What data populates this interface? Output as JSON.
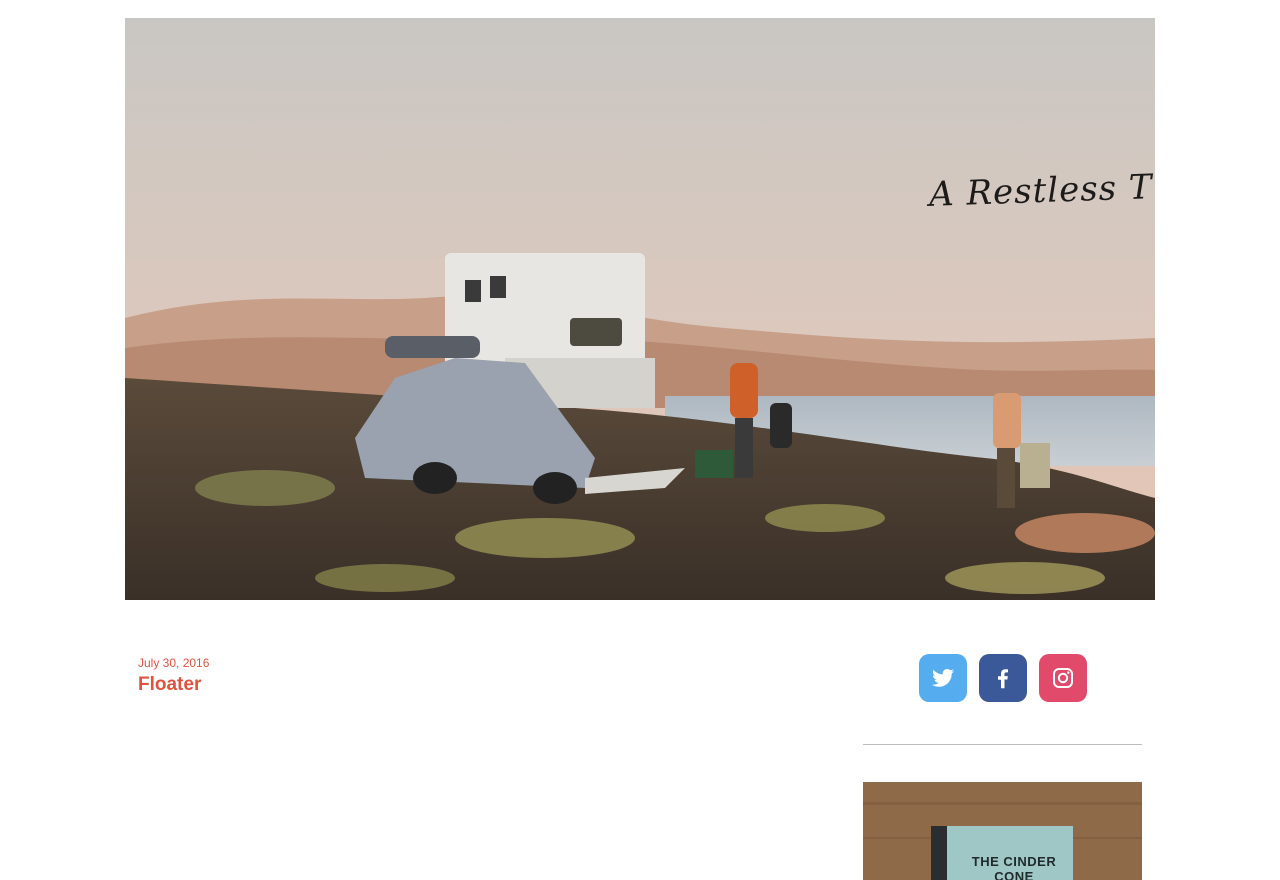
{
  "hero": {
    "title_text": "A Restless Transplant"
  },
  "post": {
    "date": "July 30, 2016",
    "title": "Floater"
  },
  "social": {
    "items": [
      {
        "name": "twitter",
        "icon": "twitter-icon",
        "color": "#55acee"
      },
      {
        "name": "facebook",
        "icon": "facebook-icon",
        "color": "#3b5998"
      },
      {
        "name": "instagram",
        "icon": "instagram-icon",
        "color": "#e14a6b"
      }
    ]
  },
  "sidebar": {
    "book_title": "THE CINDER CONE"
  },
  "colors": {
    "accent": "#e0533e"
  }
}
